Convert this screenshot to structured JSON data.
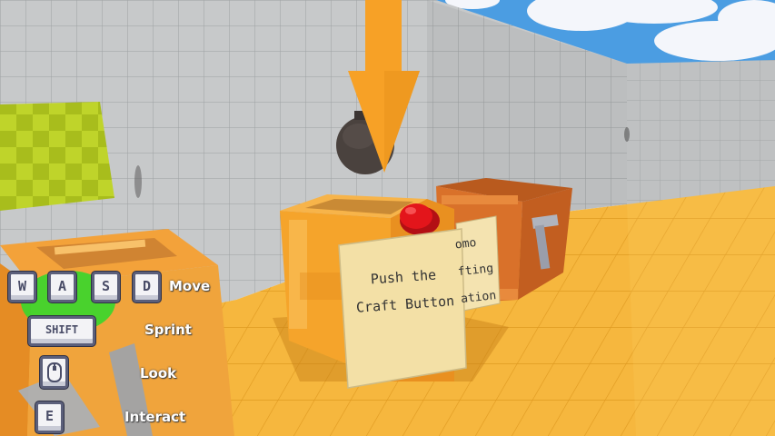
{
  "note": {
    "line1": "Push the",
    "line2": "Craft Button"
  },
  "back_note": {
    "line1": "omo",
    "line2": "fting",
    "line3": "ation"
  },
  "controls": [
    {
      "keys": [
        "W",
        "A",
        "S",
        "D"
      ],
      "action": "Move"
    },
    {
      "keys": [
        "SHIFT"
      ],
      "action": "Sprint"
    },
    {
      "keys": [
        "mouse"
      ],
      "action": "Look"
    },
    {
      "keys": [
        "E"
      ],
      "action": "Interact"
    }
  ],
  "colors": {
    "sky": "#4a9be0",
    "wall": "#c3c5c6",
    "floor": "#f3b33b",
    "crate_front": "#f5a42b",
    "crate_back": "#d46a24",
    "arrow": "#f7a126",
    "craft_button": "#e3151b",
    "note_paper": "#f2dfa2",
    "highlight_green": "#3bd62c"
  },
  "icons": {
    "look": "mouse-icon"
  }
}
